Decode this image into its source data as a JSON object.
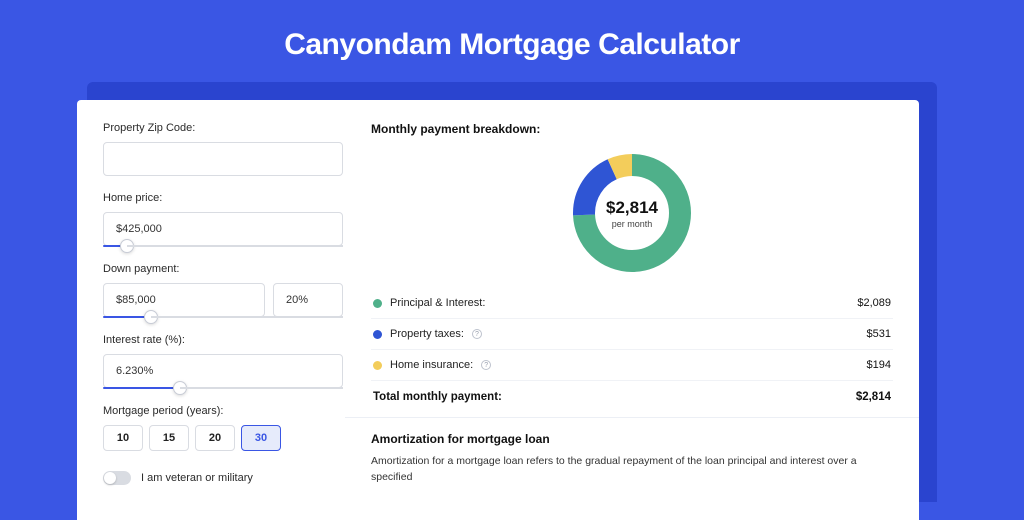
{
  "hero": {
    "title": "Canyondam Mortgage Calculator"
  },
  "form": {
    "zip_label": "Property Zip Code:",
    "zip_value": "",
    "homeprice_label": "Home price:",
    "homeprice_value": "$425,000",
    "downpayment_label": "Down payment:",
    "downpayment_value": "$85,000",
    "downpayment_pct": "20%",
    "rate_label": "Interest rate (%):",
    "rate_value": "6.230%",
    "period_label": "Mortgage period (years):",
    "periods": [
      "10",
      "15",
      "20",
      "30"
    ],
    "period_active": "30",
    "veteran_label": "I am veteran or military"
  },
  "breakdown": {
    "heading": "Monthly payment breakdown:",
    "center_amount": "$2,814",
    "center_sub": "per month",
    "items": [
      {
        "label": "Principal & Interest:",
        "value": "$2,089",
        "color": "green",
        "info": false
      },
      {
        "label": "Property taxes:",
        "value": "$531",
        "color": "blue",
        "info": true
      },
      {
        "label": "Home insurance:",
        "value": "$194",
        "color": "yellow",
        "info": true
      }
    ],
    "total_label": "Total monthly payment:",
    "total_value": "$2,814"
  },
  "amort": {
    "heading": "Amortization for mortgage loan",
    "text": "Amortization for a mortgage loan refers to the gradual repayment of the loan principal and interest over a specified"
  },
  "chart_data": {
    "type": "pie",
    "title": "Monthly payment breakdown",
    "series": [
      {
        "name": "Principal & Interest",
        "value": 2089,
        "color": "#4fb08a"
      },
      {
        "name": "Property taxes",
        "value": 531,
        "color": "#2f55d4"
      },
      {
        "name": "Home insurance",
        "value": 194,
        "color": "#f3cd5b"
      }
    ],
    "total": 2814,
    "center_label": "$2,814 per month"
  }
}
